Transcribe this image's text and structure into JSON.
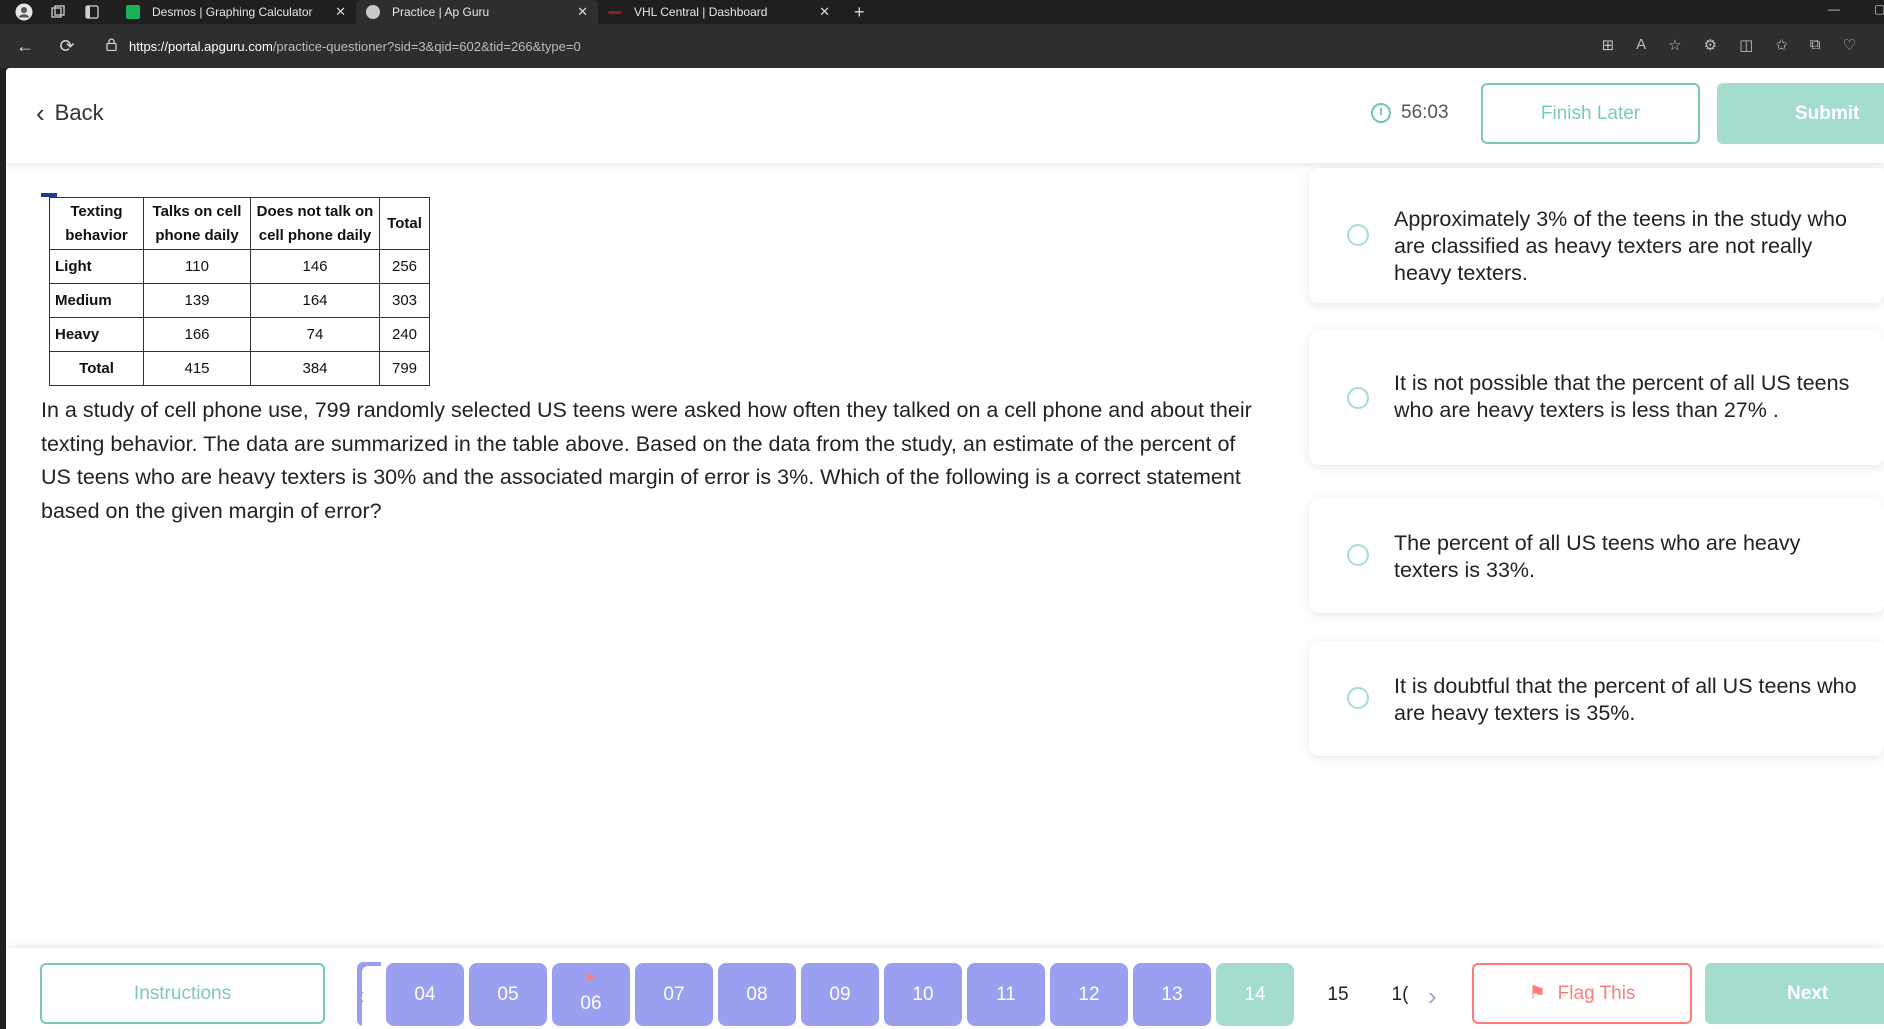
{
  "browser": {
    "tabs": [
      {
        "title": "Desmos | Graphing Calculator",
        "favicon_color": "#1bb15a"
      },
      {
        "title": "Practice | Ap Guru",
        "favicon_color": "#c9c9c9"
      },
      {
        "title": "VHL Central | Dashboard",
        "favicon_color": "#8b1e1e"
      }
    ],
    "url_host": "https://portal.apguru.com",
    "url_path": "/practice-questioner?sid=3&qid=602&tid=266&type=0"
  },
  "header": {
    "back_label": "Back",
    "timer": "56:03",
    "finish_later_label": "Finish Later",
    "submit_label": "Submit"
  },
  "table": {
    "headers": [
      "Texting behavior",
      "Talks on cell phone daily",
      "Does not talk on cell phone daily",
      "Total"
    ],
    "rows": [
      [
        "Light",
        "110",
        "146",
        "256"
      ],
      [
        "Medium",
        "139",
        "164",
        "303"
      ],
      [
        "Heavy",
        "166",
        "74",
        "240"
      ],
      [
        "Total",
        "415",
        "384",
        "799"
      ]
    ]
  },
  "question": "In a study of cell phone use, 799 randomly selected US teens were asked how often they talked on a cell phone and about their texting behavior. The data are summarized in the table above. Based on the data from the study, an estimate of the percent of US teens who are heavy texters is 30% and the associated margin of error is 3%. Which of the following is a correct statement based on the given margin of error?",
  "options": [
    {
      "text": "Approximately 3% of the teens in the study who are classified as heavy texters are not really heavy texters."
    },
    {
      "text": " It is not possible that the percent of all US teens who are heavy texters is less than 27% ."
    },
    {
      "text": "The percent of all US teens who are heavy texters is 33%."
    },
    {
      "text": " It is doubtful that the percent of all US teens who are heavy texters is 35%."
    }
  ],
  "footer": {
    "instructions_label": "Instructions",
    "pages": [
      "04",
      "05",
      "06",
      "07",
      "08",
      "09",
      "10",
      "11",
      "12",
      "13",
      "14",
      "15",
      "1("
    ],
    "flagged_page": "06",
    "current_page": "14",
    "flag_label": "Flag This",
    "next_label": "Next"
  },
  "colors": {
    "accent": "#7ccab5",
    "page_button": "#9b9ff0",
    "flag": "#ff7b7b"
  }
}
